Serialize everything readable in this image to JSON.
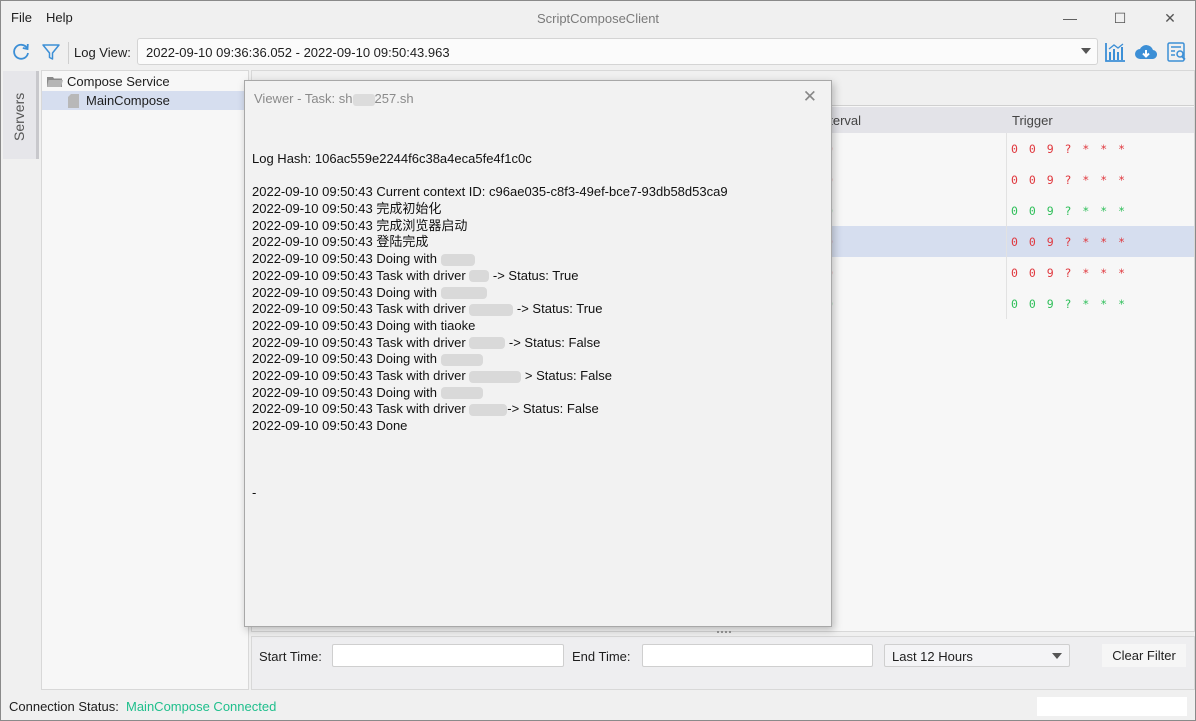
{
  "window": {
    "title": "ScriptComposeClient",
    "menu": [
      "File",
      "Help"
    ],
    "controls": {
      "minimize": "—",
      "maximize": "☐",
      "close": "✕"
    }
  },
  "toolbar": {
    "refresh_icon": "refresh-icon",
    "filter_icon": "filter-icon",
    "log_view_label": "Log View:",
    "log_view_value": "2022-09-10 09:36:36.052 - 2022-09-10 09:50:43.963",
    "right_icons": [
      "chart-icon",
      "cloud-download-icon",
      "search-document-icon"
    ]
  },
  "sidebar": {
    "tab_label": "Servers",
    "tree": [
      {
        "label": "Compose Service",
        "icon": "folder-icon",
        "level": 0,
        "selected": false
      },
      {
        "label": "MainCompose",
        "icon": "file-icon",
        "level": 1,
        "selected": true
      }
    ]
  },
  "table": {
    "columns": [
      "Interval",
      "Trigger"
    ],
    "visible_interval_header": "nterval",
    "rows": [
      {
        "interval_tail": "0",
        "trigger": "0 0 9 ? * * *",
        "status": "red",
        "selected": false
      },
      {
        "interval_tail": "0",
        "trigger": "0 0 9 ? * * *",
        "status": "red",
        "selected": false
      },
      {
        "interval_tail": "0",
        "trigger": "0 0 9 ? * * *",
        "status": "green",
        "selected": false
      },
      {
        "interval_tail": "0",
        "trigger": "0 0 9 ? * * *",
        "status": "red",
        "selected": true
      },
      {
        "interval_tail": "0",
        "trigger": "0 0 9 ? * * *",
        "status": "red",
        "selected": false
      },
      {
        "interval_tail": "0",
        "trigger": "0 0 9 ? * * *",
        "status": "green",
        "selected": false
      }
    ],
    "colors": {
      "red": "#e0383e",
      "green": "#2fbf5a",
      "selected_bg": "#d6deef"
    }
  },
  "dialog": {
    "title_prefix": "Viewer - Task: sh",
    "title_suffix": "257.sh",
    "close_label": "✕",
    "log_hash": "Log Hash: 106ac559e2244f6c38a4eca5fe4f1c0c",
    "lines": [
      {
        "text": "2022-09-10 09:50:43 Current context ID: c96ae035-c8f3-49ef-bce7-93db58d53ca9",
        "mask": 0,
        "after": ""
      },
      {
        "text": "2022-09-10 09:50:43 完成初始化",
        "mask": 0,
        "after": ""
      },
      {
        "text": "2022-09-10 09:50:43 完成浏览器启动",
        "mask": 0,
        "after": ""
      },
      {
        "text": "2022-09-10 09:50:43 登陆完成",
        "mask": 0,
        "after": ""
      },
      {
        "text": "2022-09-10 09:50:43 Doing with ",
        "mask": 34,
        "after": ""
      },
      {
        "text": "2022-09-10 09:50:43 Task with driver ",
        "mask": 20,
        "after": " -> Status: True"
      },
      {
        "text": "2022-09-10 09:50:43 Doing with ",
        "mask": 46,
        "after": ""
      },
      {
        "text": "2022-09-10 09:50:43 Task with driver ",
        "mask": 44,
        "after": " -> Status: True"
      },
      {
        "text": "2022-09-10 09:50:43 Doing with tiaoke",
        "mask": 0,
        "after": ""
      },
      {
        "text": "2022-09-10 09:50:43 Task with driver ",
        "mask": 36,
        "after": " -> Status: False"
      },
      {
        "text": "2022-09-10 09:50:43 Doing with ",
        "mask": 42,
        "after": ""
      },
      {
        "text": "2022-09-10 09:50:43 Task with driver ",
        "mask": 52,
        "after": " > Status: False"
      },
      {
        "text": "2022-09-10 09:50:43 Doing with ",
        "mask": 42,
        "after": ""
      },
      {
        "text": "2022-09-10 09:50:43 Task with driver ",
        "mask": 38,
        "after": "-> Status: False"
      },
      {
        "text": "2022-09-10 09:50:43 Done",
        "mask": 0,
        "after": ""
      }
    ],
    "trailing": "-"
  },
  "filter": {
    "start_label": "Start Time:",
    "start_value": "",
    "end_label": "End Time:",
    "end_value": "",
    "range_value": "Last 12 Hours",
    "clear_label": "Clear Filter"
  },
  "status": {
    "label": "Connection Status:",
    "value": "MainCompose Connected",
    "value_color": "#1fbf8c"
  }
}
